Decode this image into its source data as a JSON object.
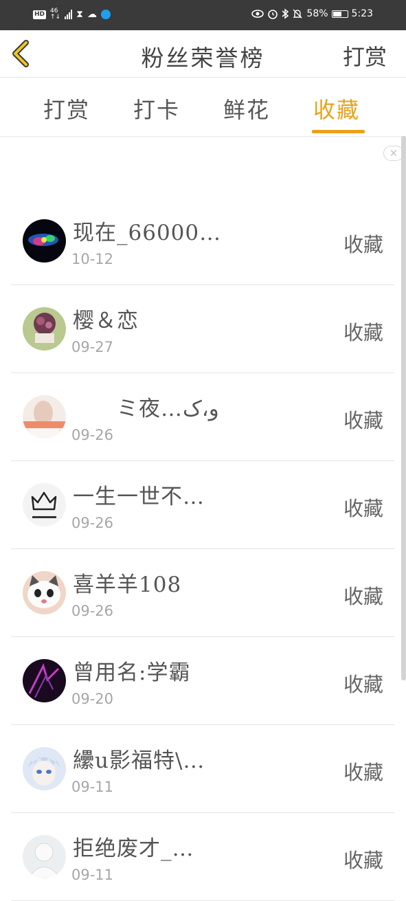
{
  "status_bar": {
    "hd": "HD",
    "net_top": "46",
    "net_bottom": "↑↓",
    "battery": "58%",
    "time": "5:23"
  },
  "header": {
    "title": "粉丝荣誉榜",
    "action_label": "打赏"
  },
  "tabs": [
    {
      "label": "打赏"
    },
    {
      "label": "打卡"
    },
    {
      "label": "鲜花"
    },
    {
      "label": "收藏"
    }
  ],
  "active_tab": "收藏",
  "close_symbol": "✕",
  "icons": {
    "back": "chevron-left-icon",
    "eye": "eye-icon",
    "alarm": "alarm-icon",
    "bluetooth": "bluetooth-icon",
    "mute": "bell-off-icon",
    "hourglass": "hourglass-icon",
    "weather": "cloud-sun-icon",
    "edge": "edge-icon"
  },
  "colors": {
    "accent": "#e9a21a",
    "statusbar": "#3a3a3a",
    "text": "#555555",
    "date": "#a6a6a6"
  },
  "fans": [
    {
      "name": "现在_66000…",
      "date": "10-12",
      "action": "收藏"
    },
    {
      "name": "樱＆恋",
      "date": "09-27",
      "action": "收藏"
    },
    {
      "name": "　　ミ夜…و،ک",
      "date": "09-26",
      "action": "收藏"
    },
    {
      "name": "一生一世不…",
      "date": "09-26",
      "action": "收藏"
    },
    {
      "name": "喜羊羊108",
      "date": "09-26",
      "action": "收藏"
    },
    {
      "name": "曾用名:学霸",
      "date": "09-20",
      "action": "收藏"
    },
    {
      "name": "纝u影福特\\…",
      "date": "09-11",
      "action": "收藏"
    },
    {
      "name": "拒绝废才_…",
      "date": "09-11",
      "action": "收藏"
    }
  ]
}
